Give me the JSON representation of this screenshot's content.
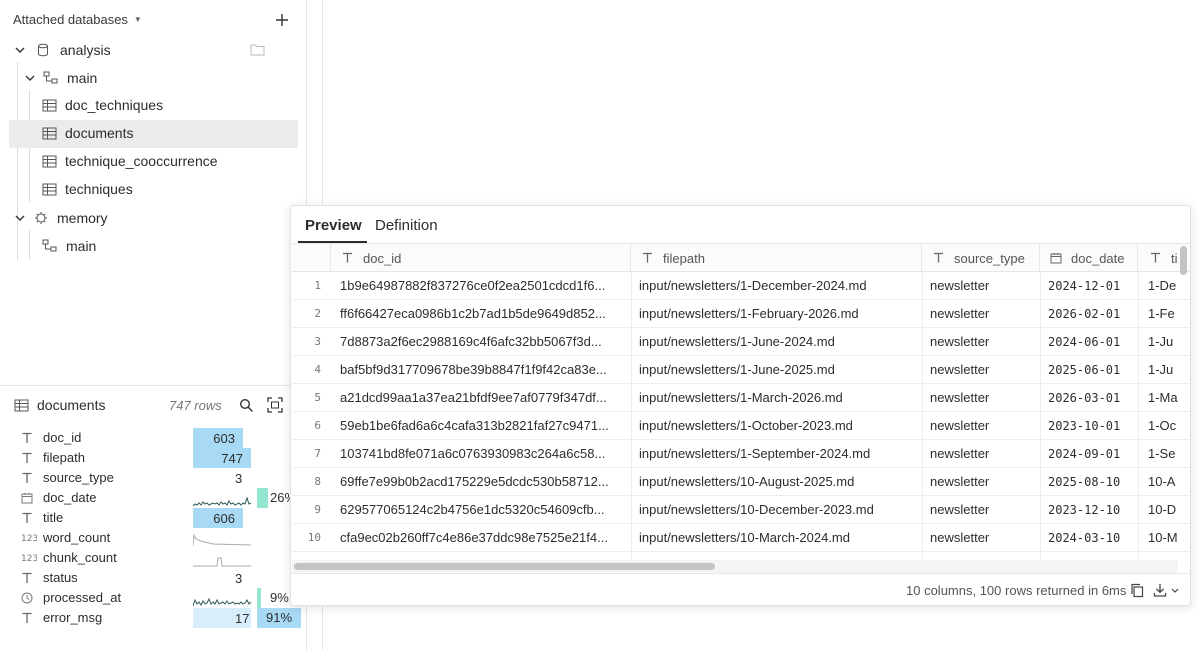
{
  "sidebar": {
    "header": "Attached databases",
    "tree": [
      {
        "label": "analysis"
      },
      {
        "label": "main"
      },
      {
        "label": "doc_techniques"
      },
      {
        "label": "documents"
      },
      {
        "label": "technique_cooccurrence"
      },
      {
        "label": "techniques"
      },
      {
        "label": "memory"
      },
      {
        "label": "main"
      }
    ]
  },
  "summary": {
    "table_name": "documents",
    "row_count": "747 rows",
    "columns": [
      {
        "name": "doc_id",
        "type_icon": "text-icon",
        "value": "603",
        "fill": 0.81
      },
      {
        "name": "filepath",
        "type_icon": "text-icon",
        "value": "747",
        "fill": 1.0
      },
      {
        "name": "source_type",
        "type_icon": "text-icon",
        "value": "3",
        "fill": 0.0
      },
      {
        "name": "doc_date",
        "type_icon": "calendar-icon",
        "value": "26%",
        "fill": null
      },
      {
        "name": "title",
        "type_icon": "text-icon",
        "value": "606",
        "fill": 0.81
      },
      {
        "name": "word_count",
        "type_icon": "number-icon",
        "value": "",
        "fill": null
      },
      {
        "name": "chunk_count",
        "type_icon": "number-icon",
        "value": "",
        "fill": null
      },
      {
        "name": "status",
        "type_icon": "text-icon",
        "value": "3",
        "fill": 0.0
      },
      {
        "name": "processed_at",
        "type_icon": "clock-icon",
        "value": "9%",
        "fill": null
      },
      {
        "name": "error_msg",
        "type_icon": "text-icon",
        "value": "17",
        "fill": 0.0,
        "pct": "91%"
      }
    ]
  },
  "preview": {
    "tabs": [
      "Preview",
      "Definition"
    ],
    "columns": [
      "doc_id",
      "filepath",
      "source_type",
      "doc_date",
      "ti"
    ],
    "rows": [
      [
        "1",
        "1b9e64987882f837276ce0f2ea2501cdcd1f6...",
        "input/newsletters/1-December-2024.md",
        "newsletter",
        "2024-12-01",
        "1-De"
      ],
      [
        "2",
        "ff6f66427eca0986b1c2b7ad1b5de9649d852...",
        "input/newsletters/1-February-2026.md",
        "newsletter",
        "2026-02-01",
        "1-Fe"
      ],
      [
        "3",
        "7d8873a2f6ec2988169c4f6afc32bb5067f3d...",
        "input/newsletters/1-June-2024.md",
        "newsletter",
        "2024-06-01",
        "1-Ju"
      ],
      [
        "4",
        "baf5bf9d317709678be39b8847f1f9f42ca83e...",
        "input/newsletters/1-June-2025.md",
        "newsletter",
        "2025-06-01",
        "1-Ju"
      ],
      [
        "5",
        "a21dcd99aa1a37ea21bfdf9ee7af0779f347df...",
        "input/newsletters/1-March-2026.md",
        "newsletter",
        "2026-03-01",
        "1-Ma"
      ],
      [
        "6",
        "59eb1be6fad6a6c4cafa313b2821faf27c9471...",
        "input/newsletters/1-October-2023.md",
        "newsletter",
        "2023-10-01",
        "1-Oc"
      ],
      [
        "7",
        "103741bd8fe071a6c0763930983c264a6c58...",
        "input/newsletters/1-September-2024.md",
        "newsletter",
        "2024-09-01",
        "1-Se"
      ],
      [
        "8",
        "69ffe7e99b0b2acd175229e5dcdc530b58712...",
        "input/newsletters/10-August-2025.md",
        "newsletter",
        "2025-08-10",
        "10-A"
      ],
      [
        "9",
        "629577065124c2b4756e1dc5320c54609cfb...",
        "input/newsletters/10-December-2023.md",
        "newsletter",
        "2023-12-10",
        "10-D"
      ],
      [
        "10",
        "cfa9ec02b260ff7c4e86e37ddc98e7525e21f4...",
        "input/newsletters/10-March-2024.md",
        "newsletter",
        "2024-03-10",
        "10-M"
      ]
    ],
    "footer": "10 columns, 100 rows returned in 6ms"
  }
}
